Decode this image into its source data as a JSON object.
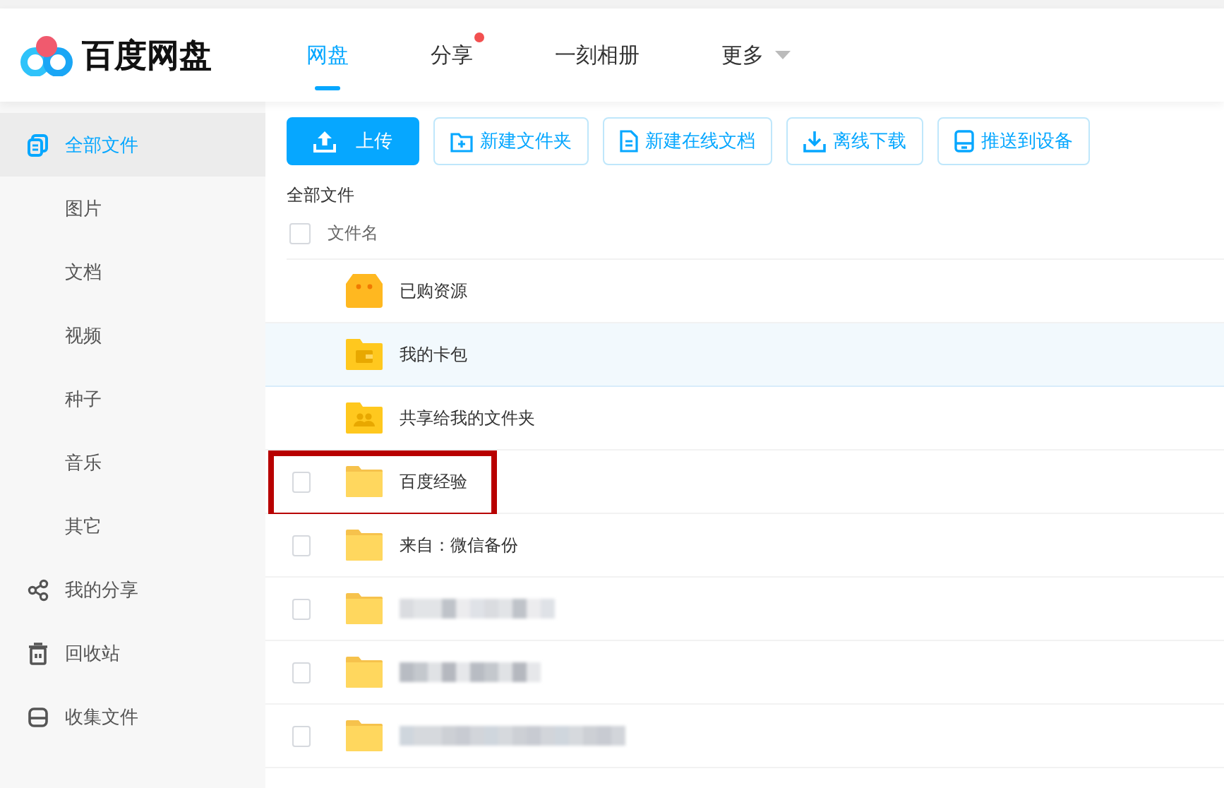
{
  "logo": {
    "name": "百度网盘"
  },
  "nav": [
    {
      "label": "网盘",
      "selected": true,
      "dot": false,
      "dropdown": false
    },
    {
      "label": "分享",
      "selected": false,
      "dot": true,
      "dropdown": false
    },
    {
      "label": "一刻相册",
      "selected": false,
      "dot": false,
      "dropdown": false
    },
    {
      "label": "更多",
      "selected": false,
      "dot": false,
      "dropdown": true
    }
  ],
  "sidebar": {
    "items": [
      {
        "label": "全部文件",
        "selected": true
      },
      {
        "label": "图片",
        "selected": false
      },
      {
        "label": "文档",
        "selected": false
      },
      {
        "label": "视频",
        "selected": false
      },
      {
        "label": "种子",
        "selected": false
      },
      {
        "label": "音乐",
        "selected": false
      },
      {
        "label": "其它",
        "selected": false
      },
      {
        "label": "我的分享",
        "selected": false
      },
      {
        "label": "回收站",
        "selected": false
      },
      {
        "label": "收集文件",
        "selected": false
      }
    ]
  },
  "toolbar": [
    {
      "label": "上传",
      "kind": "primary"
    },
    {
      "label": "新建文件夹",
      "kind": "outline"
    },
    {
      "label": "新建在线文档",
      "kind": "outline"
    },
    {
      "label": "离线下载",
      "kind": "outline"
    },
    {
      "label": "推送到设备",
      "kind": "outline"
    }
  ],
  "breadcrumb": "全部文件",
  "table": {
    "column": "文件名",
    "checked": false,
    "rows": [
      {
        "name": "已购资源",
        "kind": "store",
        "hover": false,
        "annotated": false,
        "redacted": false
      },
      {
        "name": "我的卡包",
        "kind": "wallet",
        "hover": true,
        "annotated": false,
        "redacted": false
      },
      {
        "name": "共享给我的文件夹",
        "kind": "shared",
        "hover": false,
        "annotated": false,
        "redacted": false
      },
      {
        "name": "百度经验",
        "kind": "folder",
        "checked": false,
        "hover": false,
        "annotated": true,
        "redacted": false
      },
      {
        "name": "来自：微信备份",
        "kind": "folder",
        "checked": false,
        "hover": false,
        "annotated": false,
        "redacted": false
      },
      {
        "kind": "folder",
        "checked": false,
        "hover": false,
        "annotated": false,
        "redacted": true
      },
      {
        "kind": "folder",
        "checked": false,
        "hover": false,
        "annotated": false,
        "redacted": true
      },
      {
        "kind": "folder",
        "checked": false,
        "hover": false,
        "annotated": false,
        "redacted": true
      }
    ]
  }
}
